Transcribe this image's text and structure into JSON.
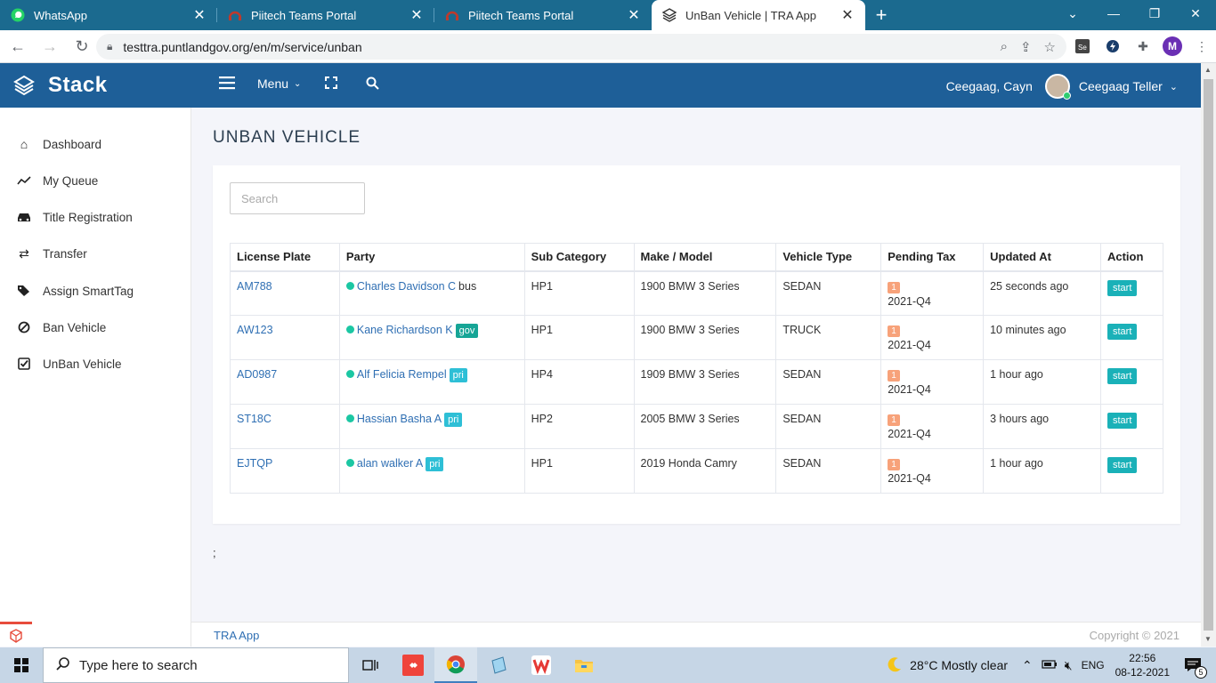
{
  "browser": {
    "tabs": [
      {
        "title": "WhatsApp",
        "icon": "whatsapp-icon",
        "active": false
      },
      {
        "title": "Piitech Teams Portal",
        "icon": "headset-icon",
        "active": false
      },
      {
        "title": "Piitech Teams Portal",
        "icon": "headset-icon",
        "active": false
      },
      {
        "title": "UnBan Vehicle | TRA App",
        "icon": "stack-icon",
        "active": true
      }
    ],
    "url": "testtra.puntlandgov.org/en/m/service/unban",
    "profile_initial": "M"
  },
  "header": {
    "brand": "Stack",
    "menu_label": "Menu",
    "user_short": "Ceegaag, Cayn",
    "user_full": "Ceegaag Teller"
  },
  "sidebar": {
    "items": [
      {
        "label": "Dashboard",
        "icon": "home-icon"
      },
      {
        "label": "My Queue",
        "icon": "trend-icon"
      },
      {
        "label": "Title Registration",
        "icon": "car-icon"
      },
      {
        "label": "Transfer",
        "icon": "transfer-icon"
      },
      {
        "label": "Assign SmartTag",
        "icon": "tags-icon"
      },
      {
        "label": "Ban Vehicle",
        "icon": "ban-icon"
      },
      {
        "label": "UnBan Vehicle",
        "icon": "check-square-icon"
      }
    ]
  },
  "main": {
    "title": "UNBAN VEHICLE",
    "search_placeholder": "Search",
    "columns": [
      "License Plate",
      "Party",
      "Sub Category",
      "Make / Model",
      "Vehicle Type",
      "Pending Tax",
      "Updated At",
      "Action"
    ],
    "rows": [
      {
        "plate": "AM788",
        "party": "Charles Davidson C",
        "party_tag": "bus",
        "tag_type": "plain",
        "sub": "HP1",
        "model": "1900 BMW 3 Series",
        "vtype": "SEDAN",
        "tax_count": "1",
        "tax_q": "2021-Q4",
        "updated": "25 seconds ago",
        "action": "start"
      },
      {
        "plate": "AW123",
        "party": "Kane Richardson K",
        "party_tag": "gov",
        "tag_type": "gov",
        "sub": "HP1",
        "model": "1900 BMW 3 Series",
        "vtype": "TRUCK",
        "tax_count": "1",
        "tax_q": "2021-Q4",
        "updated": "10 minutes ago",
        "action": "start"
      },
      {
        "plate": "AD0987",
        "party": "Alf Felicia Rempel",
        "party_tag": "pri",
        "tag_type": "pri",
        "sub": "HP4",
        "model": "1909 BMW 3 Series",
        "vtype": "SEDAN",
        "tax_count": "1",
        "tax_q": "2021-Q4",
        "updated": "1 hour ago",
        "action": "start"
      },
      {
        "plate": "ST18C",
        "party": "Hassian Basha A",
        "party_tag": "pri",
        "tag_type": "pri",
        "sub": "HP2",
        "model": "2005 BMW 3 Series",
        "vtype": "SEDAN",
        "tax_count": "1",
        "tax_q": "2021-Q4",
        "updated": "3 hours ago",
        "action": "start"
      },
      {
        "plate": "EJTQP",
        "party": "alan walker A",
        "party_tag": "pri",
        "tag_type": "pri",
        "sub": "HP1",
        "model": "2019 Honda Camry",
        "vtype": "SEDAN",
        "tax_count": "1",
        "tax_q": "2021-Q4",
        "updated": "1 hour ago",
        "action": "start"
      }
    ],
    "trailing_text": ";"
  },
  "footer": {
    "left": "TRA App",
    "right": "Copyright © 2021"
  },
  "taskbar": {
    "search_placeholder": "Type here to search",
    "weather": "28°C  Mostly clear",
    "lang": "ENG",
    "time": "22:56",
    "date": "08-12-2021",
    "notif_count": "5"
  },
  "colors": {
    "tabstrip": "#1b6a8f",
    "appbar": "#1e5f98",
    "link": "#2f6fb3",
    "start_button": "#1ab1b8",
    "tax_badge": "#f7a27a"
  }
}
